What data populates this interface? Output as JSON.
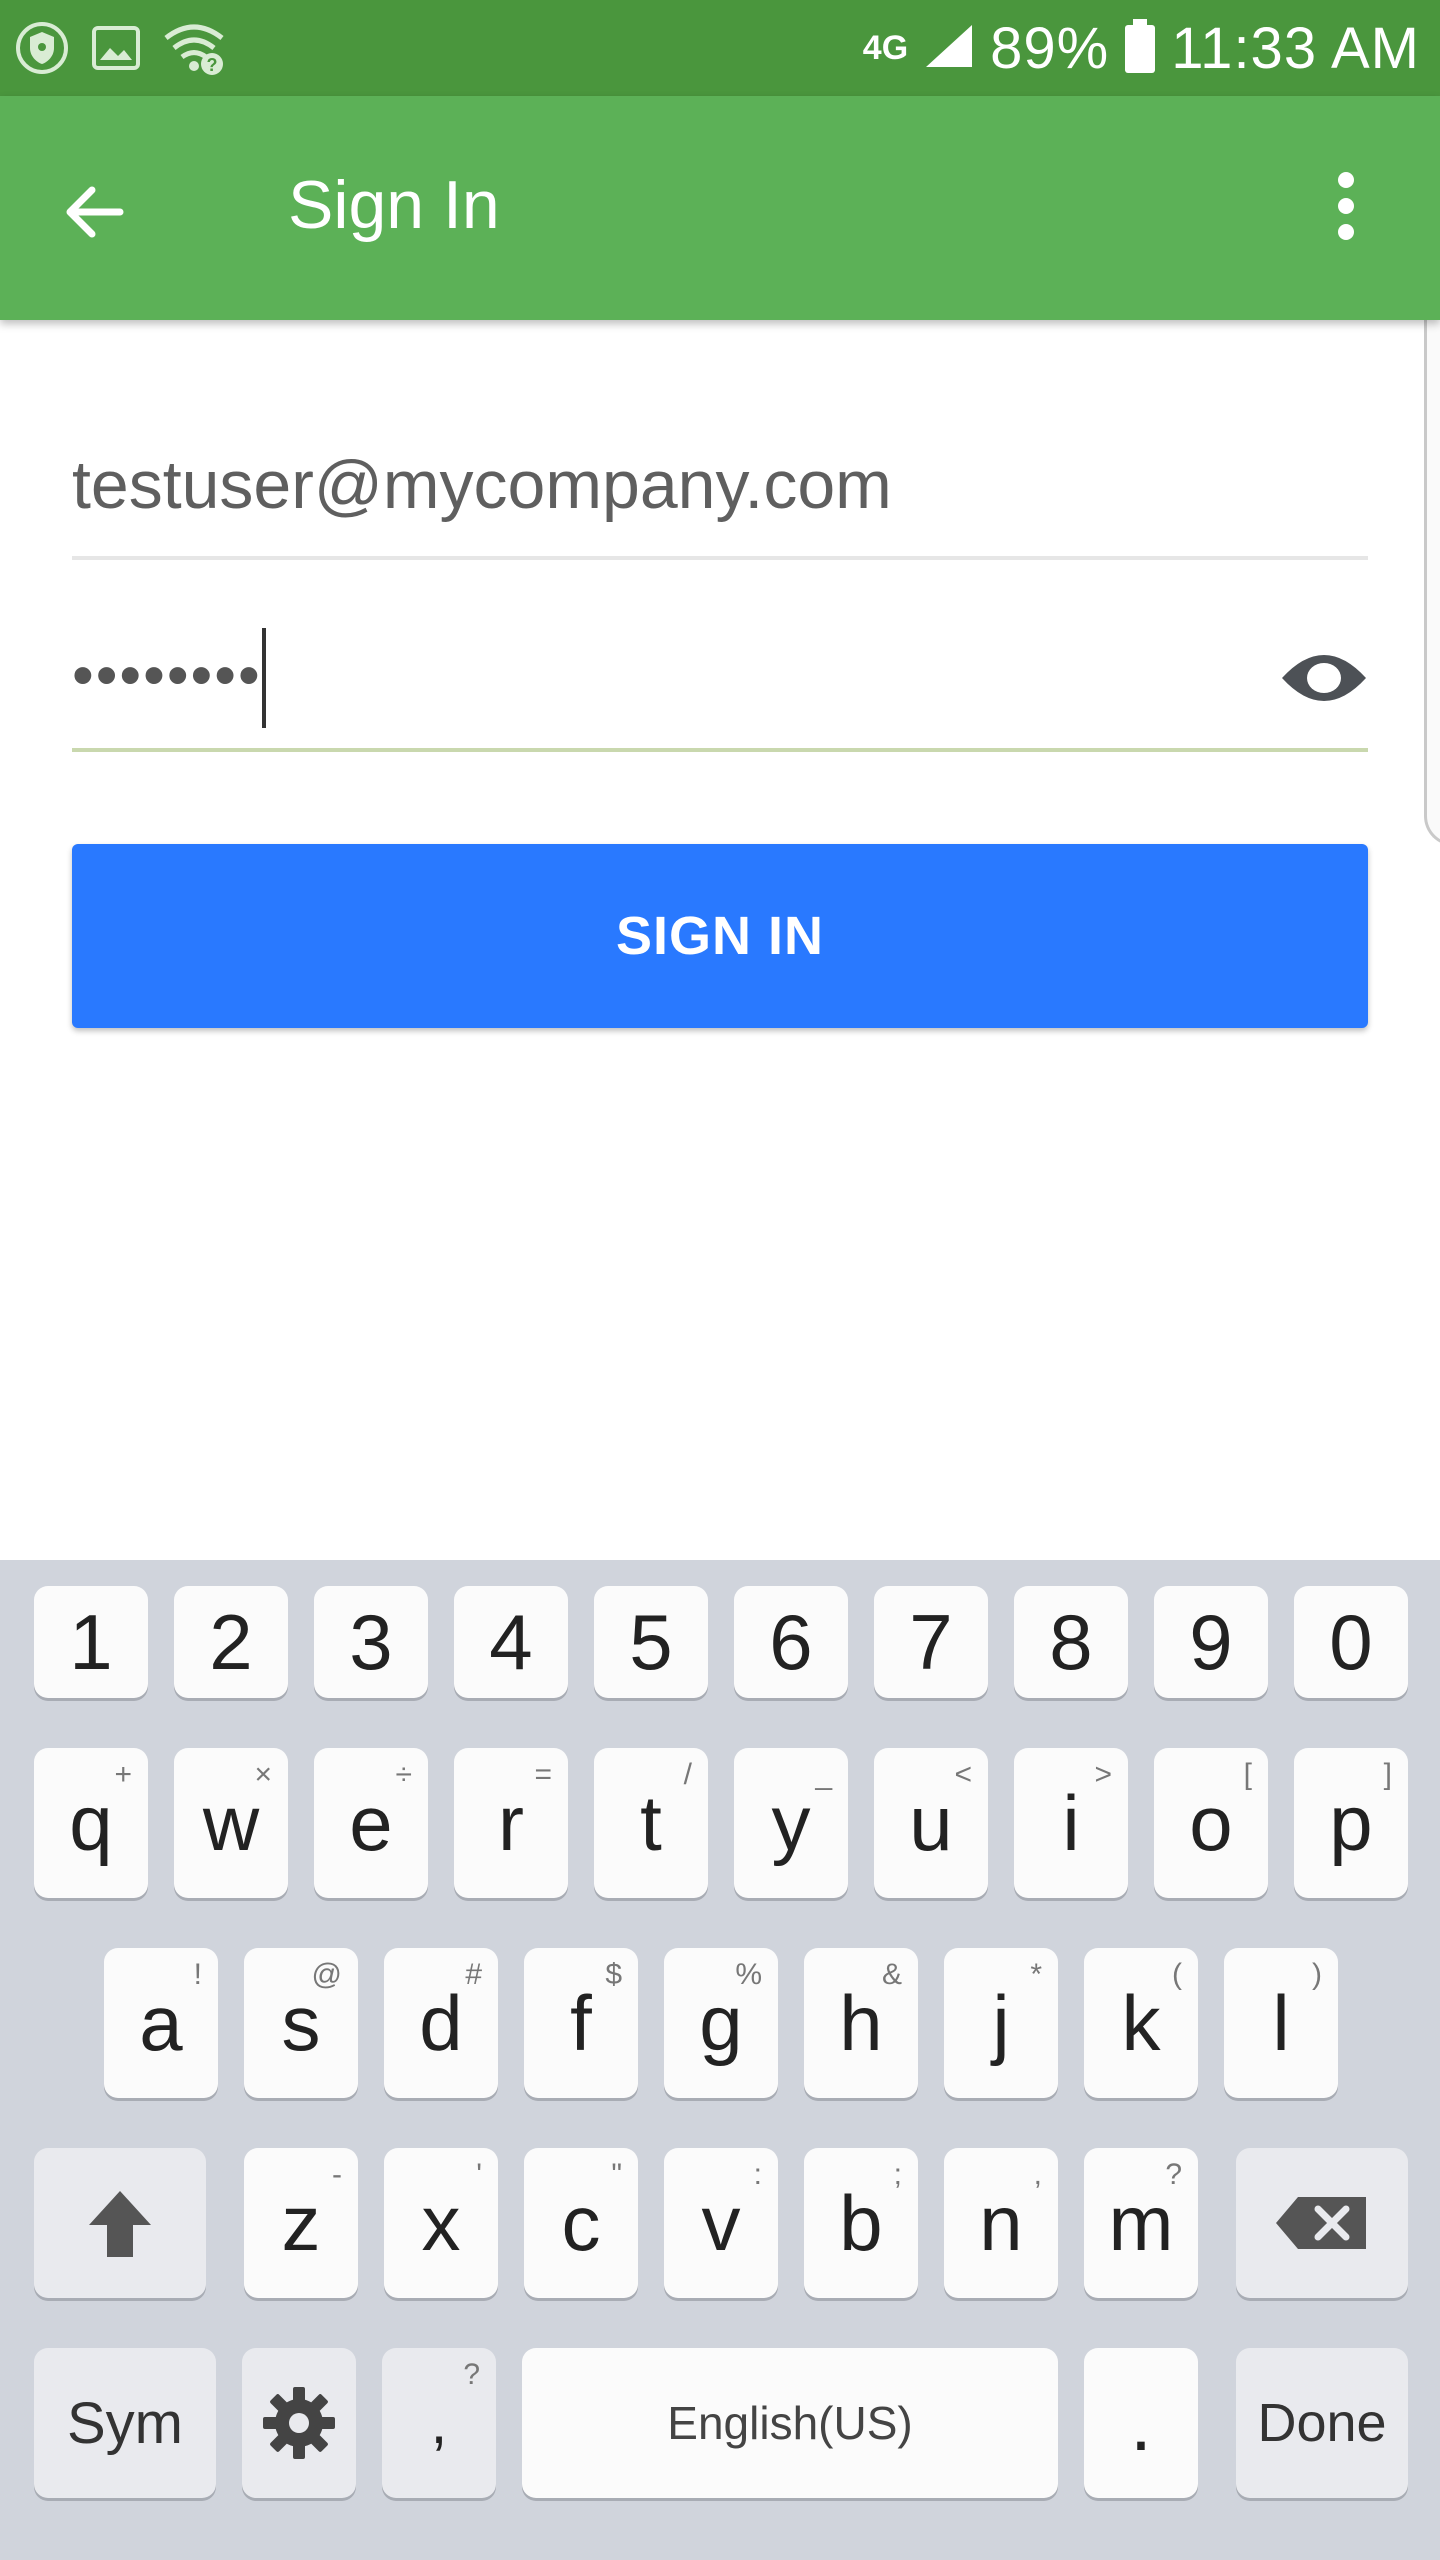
{
  "status_bar": {
    "network": "4G",
    "battery_percent": "89%",
    "time": "11:33 AM",
    "icons": [
      "shield-icon",
      "image-icon",
      "wifi-question-icon",
      "signal-icon",
      "battery-icon"
    ]
  },
  "appbar": {
    "title": "Sign In",
    "back_icon": "arrow-left-icon",
    "overflow_icon": "more-vert-icon",
    "color": "#5cb157"
  },
  "form": {
    "email_value": "testuser@mycompany.com",
    "password_value": "••••••••",
    "signin_label": "SIGN IN",
    "button_color": "#2979ff"
  },
  "keyboard": {
    "number_row": [
      "1",
      "2",
      "3",
      "4",
      "5",
      "6",
      "7",
      "8",
      "9",
      "0"
    ],
    "row1": [
      {
        "key": "q",
        "hint": "+"
      },
      {
        "key": "w",
        "hint": "×"
      },
      {
        "key": "e",
        "hint": "÷"
      },
      {
        "key": "r",
        "hint": "="
      },
      {
        "key": "t",
        "hint": "/"
      },
      {
        "key": "y",
        "hint": "_"
      },
      {
        "key": "u",
        "hint": "<"
      },
      {
        "key": "i",
        "hint": ">"
      },
      {
        "key": "o",
        "hint": "["
      },
      {
        "key": "p",
        "hint": "]"
      }
    ],
    "row2": [
      {
        "key": "a",
        "hint": "!"
      },
      {
        "key": "s",
        "hint": "@"
      },
      {
        "key": "d",
        "hint": "#"
      },
      {
        "key": "f",
        "hint": "$"
      },
      {
        "key": "g",
        "hint": "%"
      },
      {
        "key": "h",
        "hint": "&"
      },
      {
        "key": "j",
        "hint": "*"
      },
      {
        "key": "k",
        "hint": "("
      },
      {
        "key": "l",
        "hint": ")"
      }
    ],
    "row3": [
      {
        "key": "z",
        "hint": "-"
      },
      {
        "key": "x",
        "hint": "'"
      },
      {
        "key": "c",
        "hint": "\""
      },
      {
        "key": "v",
        "hint": ":"
      },
      {
        "key": "b",
        "hint": ";"
      },
      {
        "key": "n",
        "hint": ","
      },
      {
        "key": "m",
        "hint": "?"
      }
    ],
    "sym_label": "Sym",
    "comma_key": ",",
    "comma_hint": "?",
    "space_label": "English(US)",
    "period_key": ".",
    "done_label": "Done"
  }
}
